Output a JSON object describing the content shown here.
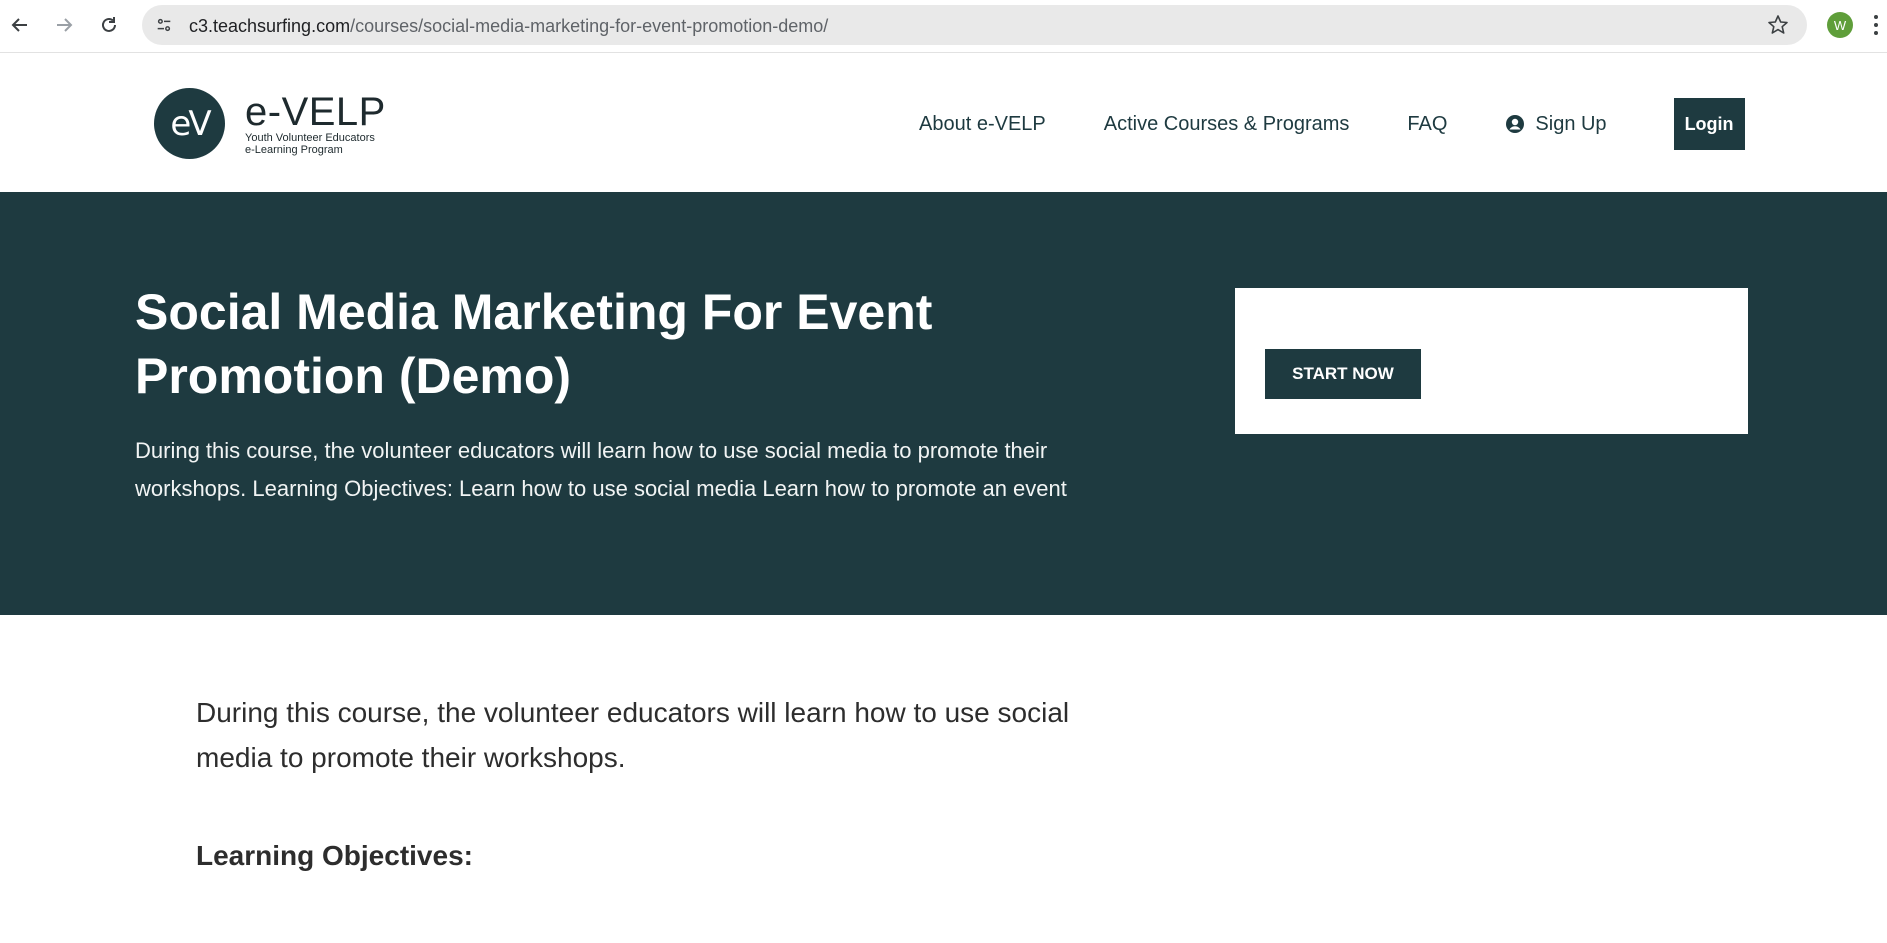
{
  "browser": {
    "url_domain": "c3.teachsurfing.com",
    "url_path": "/courses/social-media-marketing-for-event-promotion-demo/",
    "profile_initial": "W"
  },
  "header": {
    "logo_mark": "eV",
    "logo_name": "e-VELP",
    "logo_tag_line1": "Youth Volunteer Educators",
    "logo_tag_line2": "e-Learning Program",
    "nav": {
      "about": "About e-VELP",
      "courses": "Active Courses & Programs",
      "faq": "FAQ",
      "signup": "Sign Up",
      "login": "Login"
    }
  },
  "hero": {
    "title": "Social Media Marketing For Event Promotion (Demo)",
    "description": "During this course, the volunteer educators will learn how to use social media to promote their workshops. Learning Objectives: Learn how to use social media Learn how to promote an event",
    "start_button": "START NOW"
  },
  "content": {
    "intro": "During this course, the volunteer educators will learn how to use social media to promote their workshops.",
    "objectives_heading": "Learning Objectives:"
  },
  "colors": {
    "brand_dark": "#1e3a40",
    "profile_green": "#5f9e3a"
  }
}
